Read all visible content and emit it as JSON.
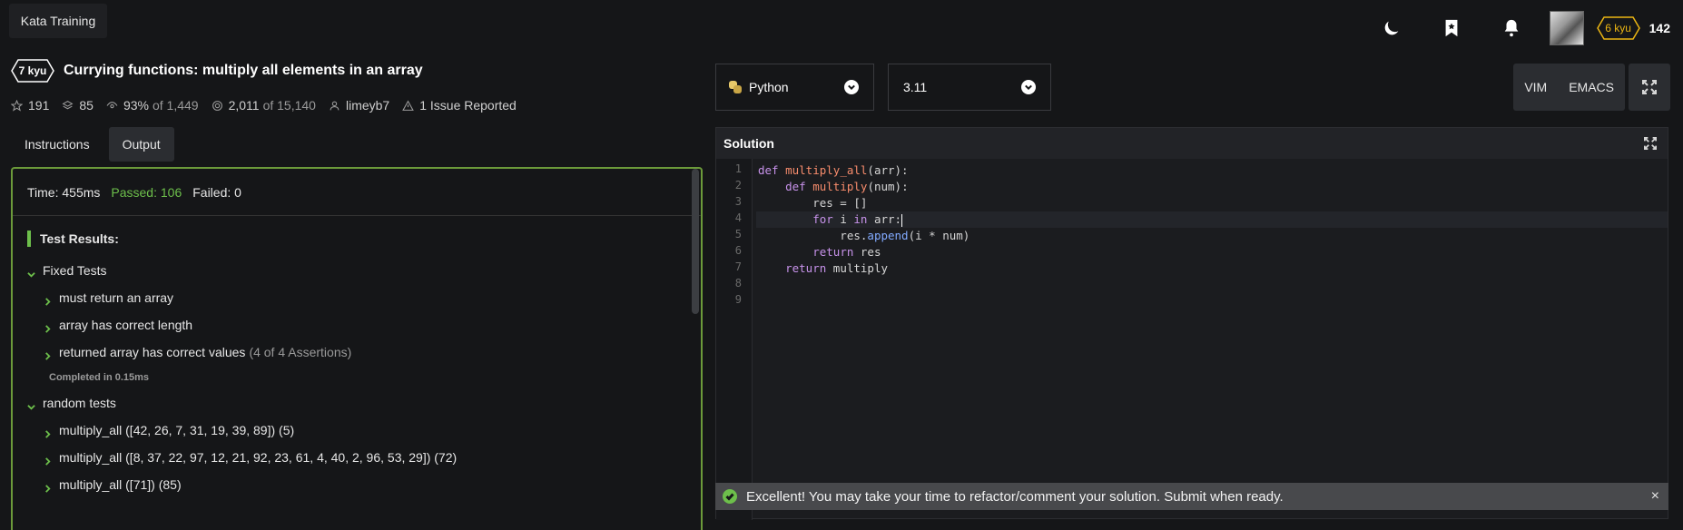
{
  "header": {
    "brand_label": "Kata Training",
    "icons": [
      "moon-icon",
      "bookmark-icon",
      "bell-icon"
    ],
    "user_rank": "6 kyu",
    "honor": "142",
    "rank_color": "#ecb613"
  },
  "kata": {
    "rank": "7 kyu",
    "title": "Currying functions: multiply all elements in an array",
    "stats": {
      "stars": "191",
      "collections": "85",
      "satisfaction": "93%",
      "satisfaction_of": "of 1,449",
      "completed": "2,011",
      "completed_of": "of 15,140",
      "author": "limeyb7",
      "issues": "1 Issue Reported"
    }
  },
  "tabs": [
    {
      "label": "Instructions",
      "active": false
    },
    {
      "label": "Output",
      "active": true
    }
  ],
  "output": {
    "time": "Time: 455ms",
    "passed": "Passed: 106",
    "failed": "Failed: 0",
    "results_title": "Test Results:",
    "fixed_group": "Fixed Tests",
    "fixed_tests": [
      {
        "label": "must return an array",
        "extra": ""
      },
      {
        "label": "array has correct length",
        "extra": ""
      },
      {
        "label": "returned array has correct values",
        "extra": "(4 of 4 Assertions)"
      }
    ],
    "completed": "Completed in 0.15ms",
    "random_group": "random tests",
    "random_tests": [
      "multiply_all ([42, 26, 7, 31, 19, 39, 89]) (5)",
      "multiply_all ([8, 37, 22, 97, 12, 21, 92, 23, 61, 4, 40, 2, 96, 53, 29]) (72)",
      "multiply_all ([71]) (85)"
    ],
    "accent": "#6dbf4b"
  },
  "editor": {
    "language": "Python",
    "version": "3.11",
    "modes": [
      "VIM",
      "EMACS"
    ],
    "panel_title": "Solution",
    "line_numbers": [
      "1",
      "2",
      "3",
      "4",
      "5",
      "6",
      "7",
      "8",
      "9"
    ],
    "notice": "Excellent! You may take your time to refactor/comment your solution. Submit when ready.",
    "close": "×"
  }
}
